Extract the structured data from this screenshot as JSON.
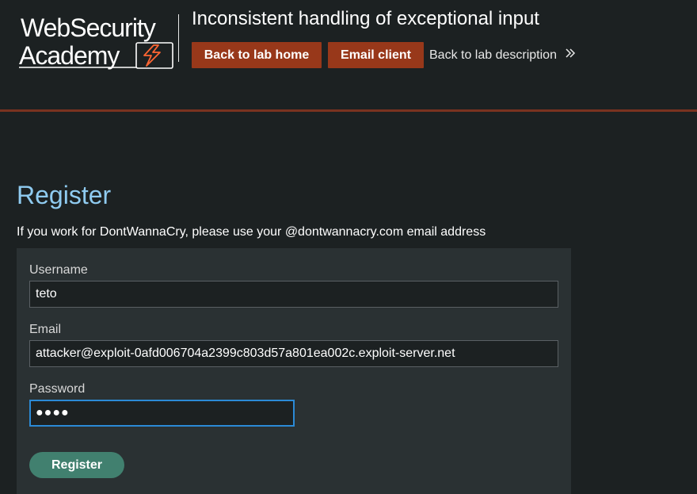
{
  "header": {
    "logo": {
      "line1": "WebSecurity",
      "line2": "Academy",
      "bolt_icon": "lightning-bolt-icon"
    },
    "lab_title": "Inconsistent handling of exceptional input",
    "buttons": {
      "back_to_lab_home": "Back to lab home",
      "email_client": "Email client"
    },
    "back_to_description": {
      "label": "Back to lab description",
      "icon": "double-chevron-right-icon"
    }
  },
  "main": {
    "heading": "Register",
    "intro": "If you work for DontWannaCry, please use your @dontwannacry.com email address",
    "form": {
      "username": {
        "label": "Username",
        "value": "teto"
      },
      "email": {
        "label": "Email",
        "value": "attacker@exploit-0afd006704a2399c803d57a801ea002c.exploit-server.net"
      },
      "password": {
        "label": "Password",
        "masked_value": "●●●●"
      },
      "submit_label": "Register"
    }
  },
  "colors": {
    "background": "#1c2122",
    "panel": "#2a3133",
    "accent_orange": "#98381a",
    "heading_blue": "#8fcbf0",
    "register_green": "#41806f",
    "focus_blue": "#2b8ad6"
  }
}
